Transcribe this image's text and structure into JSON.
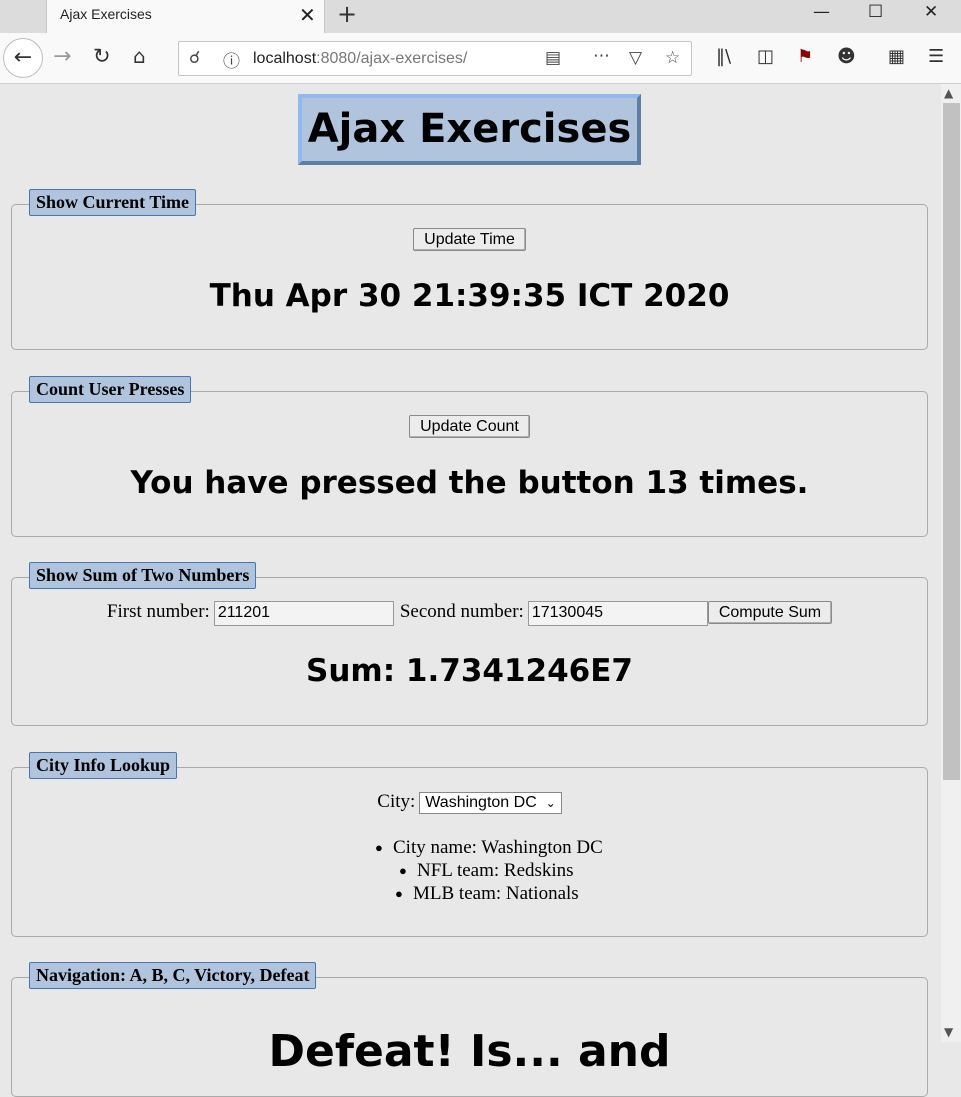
{
  "browser": {
    "tab_title": "Ajax Exercises",
    "tab_close": "✕",
    "new_tab": "+",
    "url_host": "localhost",
    "url_rest": ":8080/ajax-exercises/",
    "window_controls": {
      "minimize": "—",
      "maximize": "☐",
      "close": "✕"
    },
    "icons": [
      "back-icon",
      "forward-icon",
      "reload-icon",
      "home-icon",
      "shield-icon",
      "info-icon",
      "reader-view-icon",
      "more-icon",
      "pocket-icon",
      "bookmark-star-icon",
      "library-icon",
      "sidebar-icon",
      "ublock-icon",
      "account-icon",
      "extensions-icon",
      "menu-icon"
    ]
  },
  "page": {
    "title": "Ajax Exercises",
    "time_section": {
      "legend": "Show Current Time",
      "button": "Update Time",
      "result": "Thu Apr 30 21:39:35 ICT 2020"
    },
    "count_section": {
      "legend": "Count User Presses",
      "button": "Update Count",
      "result": "You have pressed the button 13 times."
    },
    "sum_section": {
      "legend": "Show Sum of Two Numbers",
      "first_label": "First number:",
      "first_value": "211201",
      "second_label": "Second number:",
      "second_value": "17130045",
      "button": "Compute Sum",
      "result": "Sum: 1.7341246E7"
    },
    "city_section": {
      "legend": "City Info Lookup",
      "city_label": "City:",
      "city_selected": "Washington DC",
      "info": {
        "city_name": "City name: Washington DC",
        "nfl": "NFL team: Redskins",
        "mlb": "MLB team: Nationals"
      }
    },
    "nav_section": {
      "legend": "Navigation: A, B, C, Victory, Defeat",
      "result": "Defeat! Is... and"
    }
  },
  "colors": {
    "legend_bg": "#b0c4de",
    "page_bg": "#e8e8e8"
  }
}
